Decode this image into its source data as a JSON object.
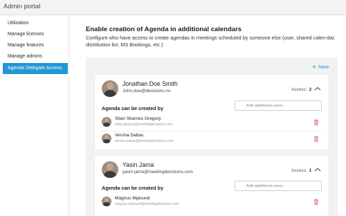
{
  "app": {
    "title": "Admin portal"
  },
  "sidebar": {
    "items": [
      {
        "label": "Utilization",
        "active": false
      },
      {
        "label": "Manage licenses",
        "active": false
      },
      {
        "label": "Manage features",
        "active": false
      },
      {
        "label": "Manage admins",
        "active": false
      },
      {
        "label": "Agenda Delegate Access",
        "active": true
      }
    ]
  },
  "main": {
    "title": "Enable creation of Agenda in additional calendars",
    "description": "Configure who have access to create agendas in meetings scheduled by someone else (user, shared calen-dar, distribution list, MS Bookings, etc.)",
    "new_button": "New",
    "new_icon": "plus-icon",
    "users": [
      {
        "name": "Jonathan Doe Smith",
        "email": "John.doe@decisions.no",
        "access_label": "Access:",
        "access_count": "2",
        "section_title": "Agenda can be created by",
        "add_placeholder": "Add additional users..",
        "delegates": [
          {
            "name": "Stian Skarnes Gregory",
            "email": "stian.gregory@meetingdecisions.com"
          },
          {
            "name": "Versha Dabas",
            "email": "versha.dabas@meetingdecisions.com"
          }
        ]
      },
      {
        "name": "Yasin Jama",
        "email": "yasin.jama@meetingdecisions.com",
        "access_label": "Access:",
        "access_count": "1",
        "section_title": "Agenda can be created by",
        "add_placeholder": "Add additional users..",
        "delegates": [
          {
            "name": "Magnus Mjøsund",
            "email": "magnus.mjosund@meetingdecisions.com"
          }
        ]
      }
    ]
  },
  "colors": {
    "accent": "#2197d3",
    "delete": "#e05050",
    "panel": "#f2f2f2"
  }
}
